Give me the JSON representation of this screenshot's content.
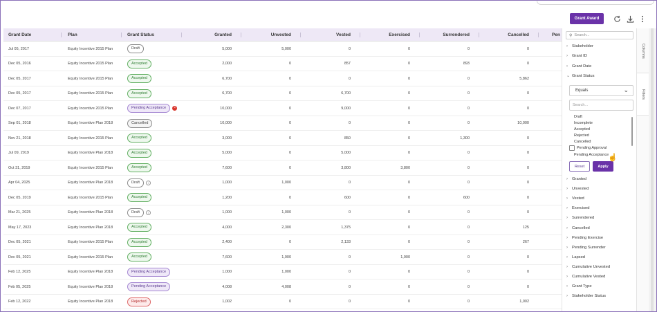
{
  "toolbar": {
    "grant_award_label": "Grant Award",
    "refresh_icon": "refresh-icon",
    "download_icon": "download-icon",
    "more_icon": "more-vertical-icon"
  },
  "columns": [
    "Grant Date",
    "Plan",
    "Grant Status",
    "Granted",
    "Unvested",
    "Vested",
    "Exercised",
    "Surrendered",
    "Cancelled",
    "Pen"
  ],
  "rows": [
    {
      "date": "Jul 05, 2017",
      "plan": "Equity Incentive 2015 Plan",
      "status": "Draft",
      "status_type": "draft",
      "granted": "5,000",
      "unvested": "5,000",
      "vested": "0",
      "exercised": "0",
      "surrendered": "0",
      "cancelled": "0"
    },
    {
      "date": "Dec 05, 2016",
      "plan": "Equity Incentive 2015 Plan",
      "status": "Accepted",
      "status_type": "accepted",
      "granted": "2,000",
      "unvested": "0",
      "vested": "857",
      "exercised": "0",
      "surrendered": "893",
      "cancelled": "0"
    },
    {
      "date": "Dec 05, 2017",
      "plan": "Equity Incentive 2015 Plan",
      "status": "Accepted",
      "status_type": "accepted",
      "granted": "6,700",
      "unvested": "0",
      "vested": "0",
      "exercised": "0",
      "surrendered": "0",
      "cancelled": "5,862"
    },
    {
      "date": "Dec 05, 2017",
      "plan": "Equity Incentive 2015 Plan",
      "status": "Accepted",
      "status_type": "accepted",
      "granted": "6,700",
      "unvested": "0",
      "vested": "6,700",
      "exercised": "0",
      "surrendered": "0",
      "cancelled": "0"
    },
    {
      "date": "Dec 07, 2017",
      "plan": "Equity Incentive 2015 Plan",
      "status": "Pending Acceptance",
      "status_type": "pending",
      "badge_extra": "error",
      "granted": "10,000",
      "unvested": "0",
      "vested": "9,000",
      "exercised": "0",
      "surrendered": "0",
      "cancelled": "0"
    },
    {
      "date": "Sep 01, 2018",
      "plan": "Equity Incentive Plan 2018",
      "status": "Cancelled",
      "status_type": "cancelled",
      "granted": "10,000",
      "unvested": "0",
      "vested": "0",
      "exercised": "0",
      "surrendered": "0",
      "cancelled": "10,000"
    },
    {
      "date": "Nov 21, 2018",
      "plan": "Equity Incentive 2015 Plan",
      "status": "Accepted",
      "status_type": "accepted",
      "granted": "3,000",
      "unvested": "0",
      "vested": "850",
      "exercised": "0",
      "surrendered": "1,300",
      "cancelled": "0"
    },
    {
      "date": "Jul 09, 2019",
      "plan": "Equity Incentive Plan 2018",
      "status": "Accepted",
      "status_type": "accepted",
      "granted": "5,000",
      "unvested": "0",
      "vested": "5,000",
      "exercised": "0",
      "surrendered": "0",
      "cancelled": "0"
    },
    {
      "date": "Oct 31, 2019",
      "plan": "Equity Incentive 2015 Plan",
      "status": "Accepted",
      "status_type": "accepted",
      "granted": "7,600",
      "unvested": "0",
      "vested": "3,800",
      "exercised": "3,800",
      "surrendered": "0",
      "cancelled": "0"
    },
    {
      "date": "Apr 04, 2025",
      "plan": "Equity Incentive Plan 2018",
      "status": "Draft",
      "status_type": "draft",
      "badge_extra": "info",
      "granted": "1,000",
      "unvested": "1,000",
      "vested": "0",
      "exercised": "0",
      "surrendered": "0",
      "cancelled": "0"
    },
    {
      "date": "Dec 05, 2019",
      "plan": "Equity Incentive 2015 Plan",
      "status": "Accepted",
      "status_type": "accepted",
      "granted": "1,200",
      "unvested": "0",
      "vested": "600",
      "exercised": "0",
      "surrendered": "600",
      "cancelled": "0"
    },
    {
      "date": "Mar 21, 2025",
      "plan": "Equity Incentive Plan 2018",
      "status": "Draft",
      "status_type": "draft",
      "badge_extra": "info",
      "granted": "1,000",
      "unvested": "1,000",
      "vested": "0",
      "exercised": "0",
      "surrendered": "0",
      "cancelled": "0"
    },
    {
      "date": "May 17, 2023",
      "plan": "Equity Incentive Plan 2018",
      "status": "Accepted",
      "status_type": "accepted",
      "granted": "4,000",
      "unvested": "2,300",
      "vested": "1,375",
      "exercised": "0",
      "surrendered": "0",
      "cancelled": "125"
    },
    {
      "date": "Dec 05, 2021",
      "plan": "Equity Incentive 2015 Plan",
      "status": "Accepted",
      "status_type": "accepted",
      "granted": "2,400",
      "unvested": "0",
      "vested": "2,133",
      "exercised": "0",
      "surrendered": "0",
      "cancelled": "267"
    },
    {
      "date": "Dec 05, 2021",
      "plan": "Equity Incentive 2015 Plan",
      "status": "Accepted",
      "status_type": "accepted",
      "granted": "7,600",
      "unvested": "1,900",
      "vested": "0",
      "exercised": "1,900",
      "surrendered": "0",
      "cancelled": "0"
    },
    {
      "date": "Feb 12, 2025",
      "plan": "Equity Incentive Plan 2018",
      "status": "Pending Acceptance",
      "status_type": "pending",
      "granted": "1,000",
      "unvested": "1,000",
      "vested": "0",
      "exercised": "0",
      "surrendered": "0",
      "cancelled": "0"
    },
    {
      "date": "Feb 05, 2025",
      "plan": "Equity Incentive Plan 2018",
      "status": "Pending Acceptance",
      "status_type": "pending",
      "granted": "4,008",
      "unvested": "4,008",
      "vested": "0",
      "exercised": "0",
      "surrendered": "0",
      "cancelled": "0"
    },
    {
      "date": "Feb 12, 2022",
      "plan": "Equity Incentive Plan 2018",
      "status": "Rejected",
      "status_type": "rejected",
      "granted": "1,002",
      "unvested": "0",
      "vested": "0",
      "exercised": "0",
      "surrendered": "0",
      "cancelled": "1,002"
    }
  ],
  "panel": {
    "search_placeholder": "Search...",
    "fields_top": [
      "Stakeholder",
      "Grant ID",
      "Grant Date",
      "Grant Status"
    ],
    "filter": {
      "operator": "Equals",
      "search_placeholder": "Search...",
      "options": [
        "Draft",
        "Incomplete",
        "Accepted",
        "Rejected",
        "Cancelled",
        "Pending Approval",
        "Pending Acceptance"
      ],
      "reset_label": "Reset",
      "apply_label": "Apply"
    },
    "fields_bottom": [
      "Granted",
      "Unvested",
      "Vested",
      "Exercised",
      "Surrendered",
      "Cancelled",
      "Pending Exercise",
      "Pending Surrender",
      "Lapsed",
      "Cumulative Unvested",
      "Cumulative Vested",
      "Grant Type",
      "Stakeholder Status"
    ]
  },
  "side_tabs": {
    "columns": "Columns",
    "filters": "Filters"
  }
}
